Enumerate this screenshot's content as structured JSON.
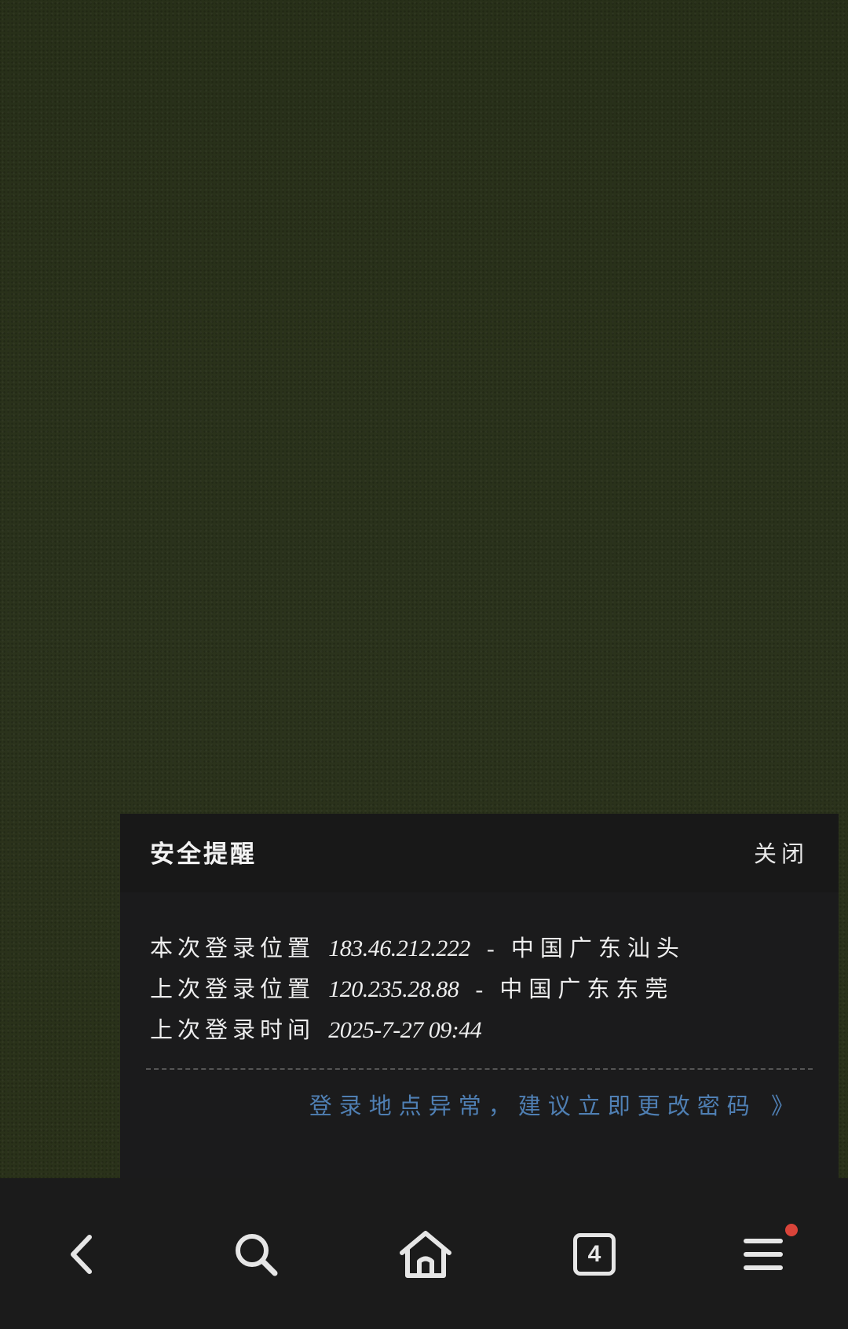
{
  "notice": {
    "title": "安全提醒",
    "close_label": "关闭",
    "lines": [
      {
        "label": "本次登录位置",
        "value": "183.46.212.222",
        "separator": "-",
        "location": "中国广东汕头"
      },
      {
        "label": "上次登录位置",
        "value": "120.235.28.88",
        "separator": "-",
        "location": "中国广东东莞"
      },
      {
        "label": "上次登录时间",
        "value": "2025-7-27 09:44"
      }
    ],
    "link_text": "登录地点异常，建议立即更改密码 》"
  },
  "toolbar": {
    "tab_count": "4",
    "icons": [
      "back-icon",
      "search-icon",
      "home-icon",
      "tabs-icon",
      "menu-icon"
    ],
    "colors": {
      "icon": "#e6e6e6",
      "badge": "#d9443a",
      "link": "#4f7fb3"
    }
  }
}
